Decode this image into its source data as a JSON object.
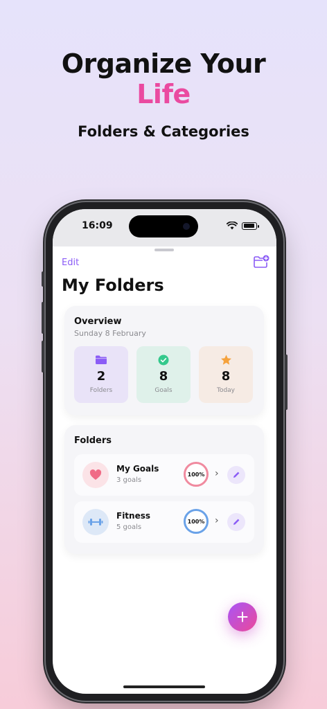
{
  "promo": {
    "headline_line1": "Organize Your",
    "headline_line2": "Life",
    "subheadline": "Folders & Categories"
  },
  "status_bar": {
    "time": "16:09"
  },
  "nav": {
    "edit_label": "Edit"
  },
  "page": {
    "title": "My Folders"
  },
  "overview": {
    "title": "Overview",
    "date": "Sunday 8 February",
    "stats": [
      {
        "value": "2",
        "label": "Folders",
        "icon": "folder-icon"
      },
      {
        "value": "8",
        "label": "Goals",
        "icon": "check-circle-icon"
      },
      {
        "value": "8",
        "label": "Today",
        "icon": "star-icon"
      }
    ]
  },
  "folders": {
    "title": "Folders",
    "items": [
      {
        "name": "My Goals",
        "count": "3 goals",
        "progress": "100%",
        "icon": "heart-icon"
      },
      {
        "name": "Fitness",
        "count": "5 goals",
        "progress": "100%",
        "icon": "dumbbell-icon"
      }
    ]
  },
  "colors": {
    "accent": "#8b5cf6",
    "headline_accent": "#ea4aa0",
    "goals_ring": "#f08a9f",
    "fitness_ring": "#6aa2e8"
  }
}
